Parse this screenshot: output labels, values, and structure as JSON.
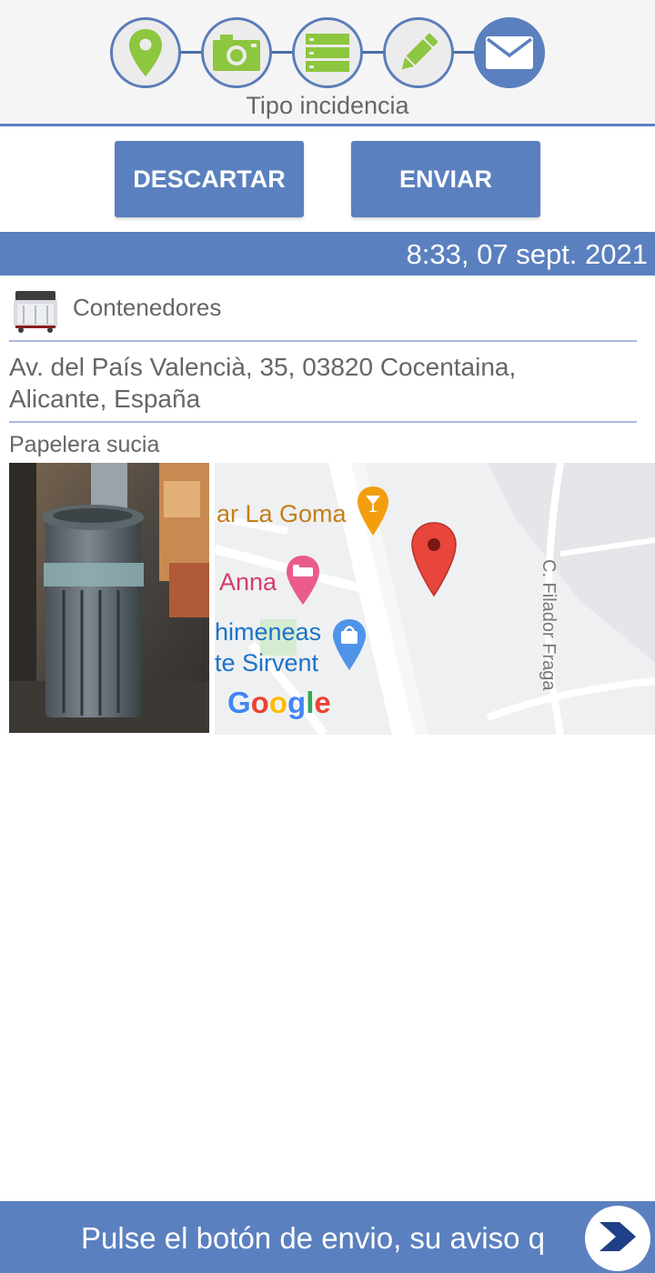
{
  "stepper": {
    "caption": "Tipo incidencia",
    "steps": [
      {
        "icon": "location-pin-icon",
        "state": "done"
      },
      {
        "icon": "camera-icon",
        "state": "done"
      },
      {
        "icon": "list-icon",
        "state": "done"
      },
      {
        "icon": "pencil-icon",
        "state": "done"
      },
      {
        "icon": "envelope-icon",
        "state": "active"
      }
    ],
    "colors": {
      "done_icon": "#8dc63f",
      "active_bg": "#5b80bf",
      "border": "#5a7dba"
    }
  },
  "actions": {
    "discard_label": "DESCARTAR",
    "send_label": "ENVIAR"
  },
  "report": {
    "datetime": "8:33, 07 sept. 2021",
    "category": "Contenedores",
    "category_icon": "container-icon",
    "address_line1": "Av. del País Valencià, 35, 03820 Cocentaina,",
    "address_line2": "Alicante, España",
    "description": "Papelera sucia"
  },
  "map": {
    "places": [
      "ar La Goma",
      "Anna",
      "himeneas",
      "te Sirvent"
    ],
    "street": "C. Filador Fraga",
    "provider_logo": "Google",
    "logo_letters": [
      "G",
      "o",
      "o",
      "g",
      "l",
      "e"
    ]
  },
  "banner": {
    "message": "Pulse el botón de envio, su aviso q",
    "next_icon": "chevron-right-icon"
  },
  "theme": {
    "primary": "#5b80bf",
    "text_muted": "#666666",
    "divider": "#a9bcdd"
  }
}
